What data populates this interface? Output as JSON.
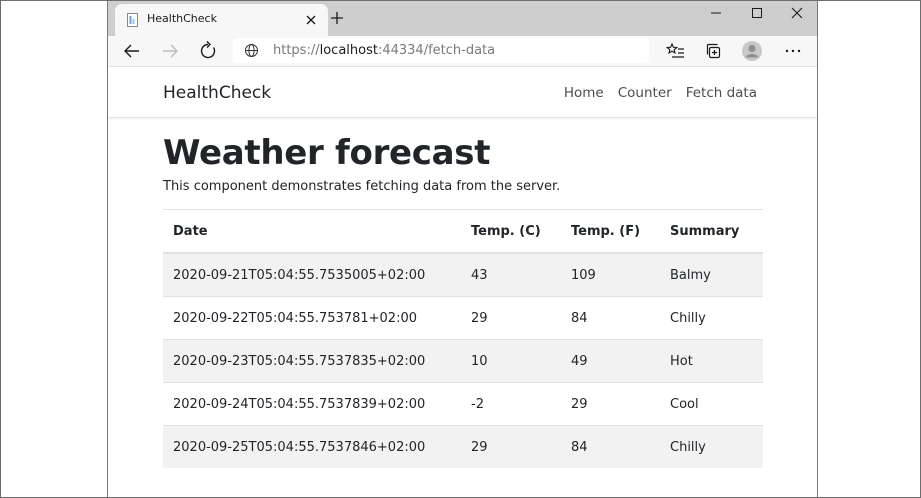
{
  "browser": {
    "tab_title": "HealthCheck",
    "address": {
      "scheme_prefix": "https://",
      "host": "localhost",
      "rest": ":44334/fetch-data"
    },
    "icons": {
      "tab_favicon": "document-icon",
      "tab_close": "close-icon",
      "new_tab": "plus-icon",
      "minimize": "minimize-icon",
      "maximize": "maximize-icon",
      "close": "close-icon",
      "back": "back-arrow-icon",
      "forward": "forward-arrow-icon",
      "refresh": "refresh-icon",
      "globe": "globe-icon",
      "favorites": "favorites-icon",
      "collections": "collections-icon",
      "profile": "profile-icon",
      "more": "more-icon"
    }
  },
  "app": {
    "brand": "HealthCheck",
    "nav": [
      "Home",
      "Counter",
      "Fetch data"
    ]
  },
  "main": {
    "title": "Weather forecast",
    "description": "This component demonstrates fetching data from the server.",
    "table": {
      "headers": [
        "Date",
        "Temp. (C)",
        "Temp. (F)",
        "Summary"
      ],
      "rows": [
        [
          "2020-09-21T05:04:55.7535005+02:00",
          "43",
          "109",
          "Balmy"
        ],
        [
          "2020-09-22T05:04:55.753781+02:00",
          "29",
          "84",
          "Chilly"
        ],
        [
          "2020-09-23T05:04:55.7537835+02:00",
          "10",
          "49",
          "Hot"
        ],
        [
          "2020-09-24T05:04:55.7537839+02:00",
          "-2",
          "29",
          "Cool"
        ],
        [
          "2020-09-25T05:04:55.7537846+02:00",
          "29",
          "84",
          "Chilly"
        ]
      ]
    }
  },
  "colors": {
    "tabstrip": "#cecece",
    "toolbar": "#f7f7f7",
    "text": "#212529",
    "stripe": "#f2f2f2",
    "border": "#dee2e6"
  }
}
